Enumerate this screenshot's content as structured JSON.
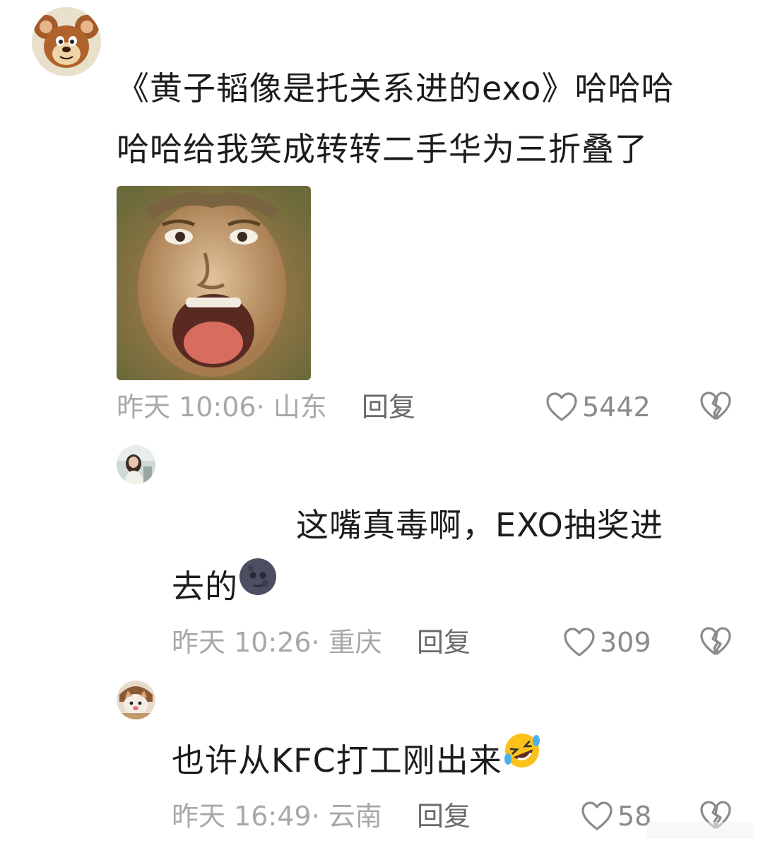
{
  "comments": [
    {
      "text_lines": [
        "《黄子韬像是托关系进的exo》哈哈哈",
        "哈哈给我笑成转转二手华为三折叠了"
      ],
      "time_location": "昨天 10:06· 山东",
      "reply_label": "回复",
      "likes": "5442",
      "avatar_icon": "cartoon-mouse-avatar",
      "attachment_icon": "monkey-face-meme-image"
    },
    {
      "text_lines": [
        "这嘴真毒啊，EXO抽奖进",
        "去的"
      ],
      "emoji": "new-moon-face-emoji",
      "time_location": "昨天 10:26· 重庆",
      "reply_label": "回复",
      "likes": "309",
      "avatar_icon": "girl-photo-avatar"
    },
    {
      "text_lines": [
        "也许从KFC打工刚出来"
      ],
      "emoji": "rolling-laughing-emoji",
      "time_location": "昨天 16:49· 云南",
      "reply_label": "回复",
      "likes": "58",
      "avatar_icon": "cat-photo-avatar"
    }
  ],
  "icons": {
    "like": "heart-outline-icon",
    "dislike": "broken-heart-icon"
  },
  "colors": {
    "text": "#1c1c1c",
    "meta": "#a8a8a8",
    "reply": "#6a6a6a",
    "icon": "#8a8a8a"
  }
}
